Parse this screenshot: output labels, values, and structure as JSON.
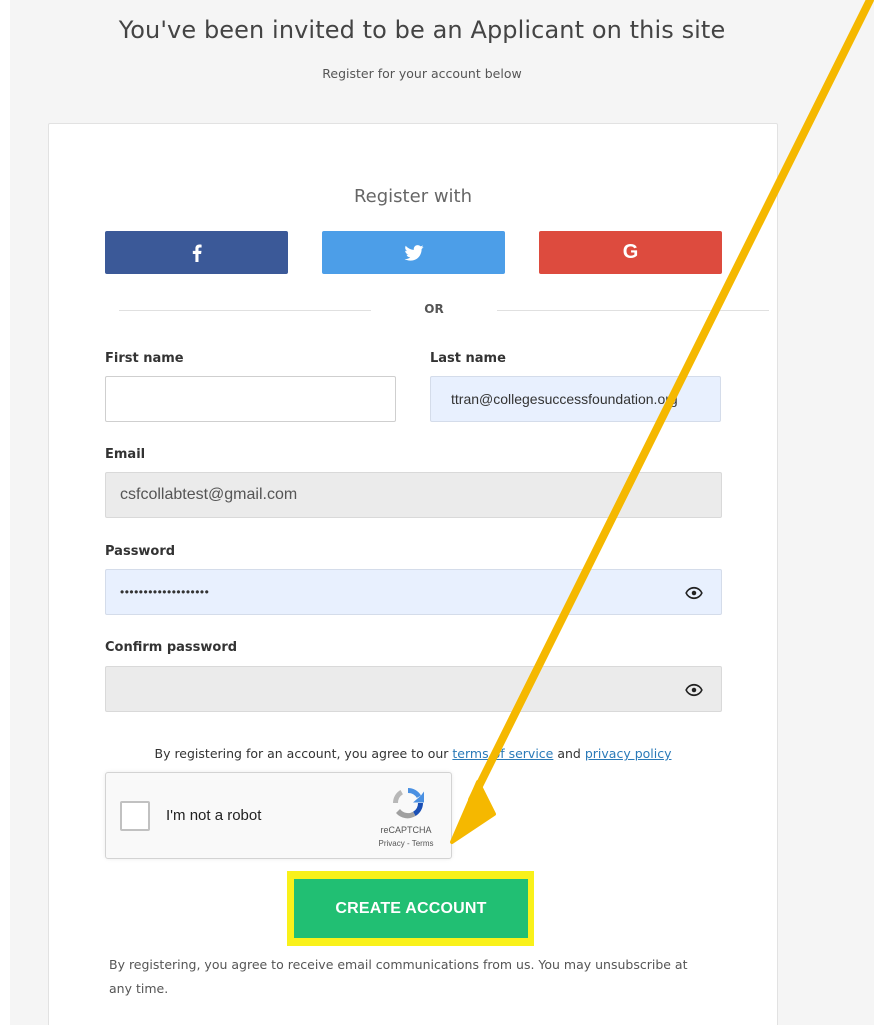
{
  "header": {
    "title": "You've been invited to be an Applicant on this site",
    "subtitle": "Register for your account below"
  },
  "register": {
    "heading": "Register with",
    "social": [
      {
        "name": "facebook",
        "icon": "facebook-icon",
        "color": "#3b5998"
      },
      {
        "name": "twitter",
        "icon": "twitter-icon",
        "color": "#4c9ee8"
      },
      {
        "name": "google",
        "icon": "google-icon",
        "color": "#dd4b3e",
        "glyph": "G"
      }
    ],
    "or_label": "OR"
  },
  "form": {
    "first_name": {
      "label": "First name",
      "value": ""
    },
    "last_name": {
      "label": "Last name",
      "value": "ttran@collegesuccessfoundation.org"
    },
    "email": {
      "label": "Email",
      "value": "csfcollabtest@gmail.com"
    },
    "password": {
      "label": "Password",
      "value": "•••••••••••••••••••"
    },
    "confirm_password": {
      "label": "Confirm password",
      "value": ""
    }
  },
  "terms": {
    "prefix": "By registering for an account, you agree to our ",
    "tos_link": "terms of service",
    "middle": " and ",
    "privacy_link": "privacy policy"
  },
  "recaptcha": {
    "label": "I'm not a robot",
    "brand": "reCAPTCHA",
    "links": "Privacy - Terms"
  },
  "actions": {
    "create_account": "CREATE ACCOUNT"
  },
  "footer": {
    "note": "By registering, you agree to receive email communications from us. You may unsubscribe at any time."
  },
  "colors": {
    "create_button": "#21bf73",
    "highlight": "#f9f11a",
    "annotation_arrow": "#f5b800"
  }
}
